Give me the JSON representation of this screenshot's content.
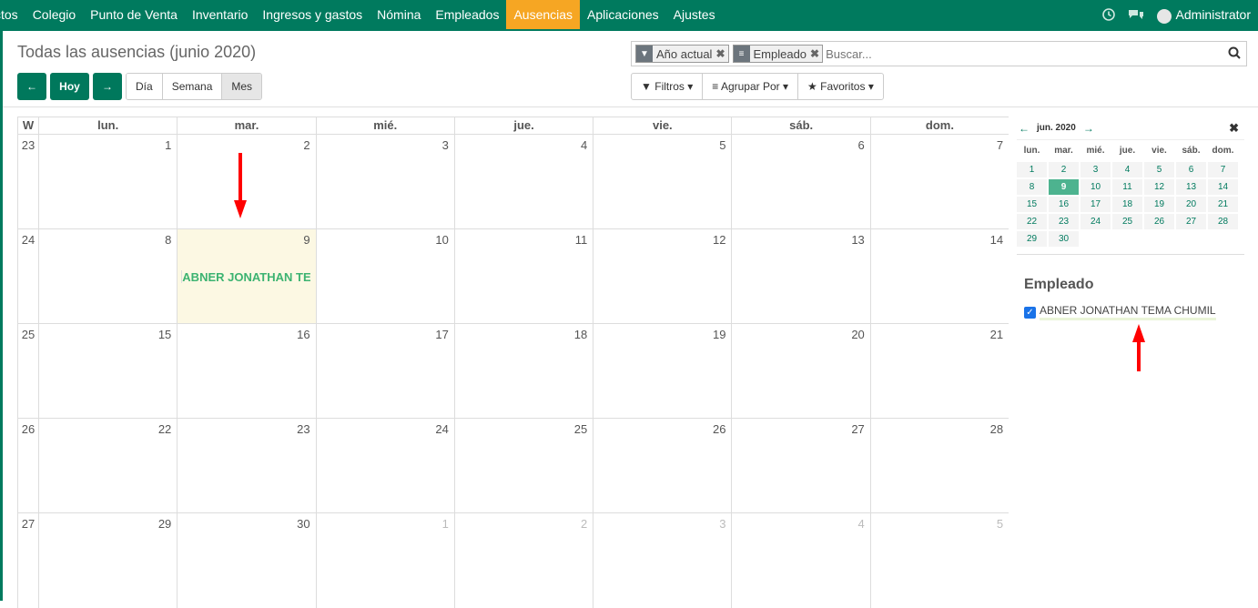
{
  "menu": [
    "ctos",
    "Colegio",
    "Punto de Venta",
    "Inventario",
    "Ingresos y gastos",
    "Nómina",
    "Empleados",
    "Ausencias",
    "Aplicaciones",
    "Ajustes"
  ],
  "menu_active": "Ausencias",
  "user": {
    "name": "Administrator"
  },
  "page": {
    "title": "Todas las ausencias (junio 2020)"
  },
  "nav": {
    "prev": "←",
    "today": "Hoy",
    "next": "→"
  },
  "scale": {
    "day": "Día",
    "week": "Semana",
    "month": "Mes",
    "active": "month"
  },
  "search": {
    "facets": [
      {
        "icon": "filter-icon",
        "value": "Año actual"
      },
      {
        "icon": "list-icon",
        "value": "Empleado"
      }
    ],
    "placeholder": "Buscar..."
  },
  "filters": {
    "filtros": "Filtros",
    "agrupar": "Agrupar Por",
    "favoritos": "Favoritos"
  },
  "calendar": {
    "week_label": "W",
    "days": [
      "lun.",
      "mar.",
      "mié.",
      "jue.",
      "vie.",
      "sáb.",
      "dom."
    ],
    "weeks": [
      {
        "no": "23",
        "days": [
          "1",
          "2",
          "3",
          "4",
          "5",
          "6",
          "7"
        ]
      },
      {
        "no": "24",
        "days": [
          "8",
          "9",
          "10",
          "11",
          "12",
          "13",
          "14"
        ]
      },
      {
        "no": "25",
        "days": [
          "15",
          "16",
          "17",
          "18",
          "19",
          "20",
          "21"
        ]
      },
      {
        "no": "26",
        "days": [
          "22",
          "23",
          "24",
          "25",
          "26",
          "27",
          "28"
        ]
      },
      {
        "no": "27",
        "days": [
          "29",
          "30",
          "1",
          "2",
          "3",
          "4",
          "5"
        ]
      }
    ],
    "event": "ABNER JONATHAN TEMA C"
  },
  "mini": {
    "month": "jun. 2020",
    "days": [
      "lun.",
      "mar.",
      "mié.",
      "jue.",
      "vie.",
      "sáb.",
      "dom."
    ],
    "rows": [
      [
        "1",
        "2",
        "3",
        "4",
        "5",
        "6",
        "7"
      ],
      [
        "8",
        "9",
        "10",
        "11",
        "12",
        "13",
        "14"
      ],
      [
        "15",
        "16",
        "17",
        "18",
        "19",
        "20",
        "21"
      ],
      [
        "22",
        "23",
        "24",
        "25",
        "26",
        "27",
        "28"
      ],
      [
        "29",
        "30",
        "",
        "",
        "",
        "",
        ""
      ]
    ]
  },
  "employee": {
    "heading": "Empleado",
    "name": "ABNER JONATHAN TEMA CHUMIL"
  },
  "colors": {
    "brand": "#007a5e",
    "active_menu": "#f6a623",
    "today": "#fcf8e3",
    "event": "#3cb371"
  }
}
